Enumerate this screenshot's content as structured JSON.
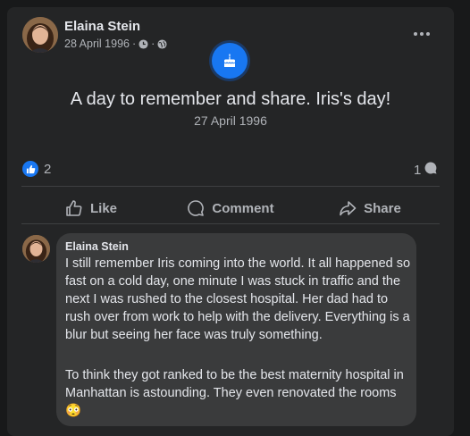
{
  "post": {
    "author": "Elaina Stein",
    "date": "28 April 1996",
    "meta_separator": "·",
    "more_icon": "more-horizontal-icon",
    "event_icon": "cake-icon",
    "event_title": "A day to remember and share. Iris's day!",
    "event_date": "27 April 1996"
  },
  "engagement": {
    "reaction_count": "2",
    "comment_count": "1"
  },
  "actions": {
    "like_label": "Like",
    "comment_label": "Comment",
    "share_label": "Share"
  },
  "comment": {
    "author": "Elaina Stein",
    "paragraph1": "I still remember Iris coming into the world. It all happened so fast on a cold day, one minute I was stuck in traffic and the next I was rushed to the closest hospital. Her dad had to rush over from work to help with the delivery. Everything is a blur but seeing her face was truly something.",
    "paragraph2": "To think they got ranked to be the best maternity hospital in Manhattan is astounding. They even renovated the rooms 😳"
  },
  "colors": {
    "background": "#18191a",
    "card": "#242526",
    "bubble": "#3a3b3c",
    "accent": "#1877f2",
    "text_primary": "#e4e6eb",
    "text_secondary": "#b0b3b8"
  }
}
